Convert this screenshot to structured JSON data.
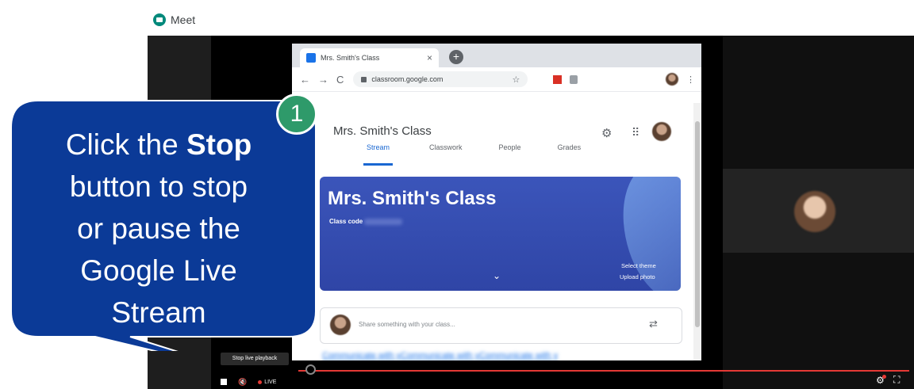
{
  "meet": {
    "title": "Meet"
  },
  "browser": {
    "tab_title": "Mrs. Smith's Class",
    "tab_close": "×",
    "new_tab": "+",
    "nav_back": "←",
    "nav_forward": "→",
    "reload": "C",
    "url": "classroom.google.com",
    "star": "☆",
    "menu": "⋮"
  },
  "classroom": {
    "class_title": "Mrs. Smith's Class",
    "tabs": [
      {
        "label": "Stream",
        "active": true
      },
      {
        "label": "Classwork",
        "active": false
      },
      {
        "label": "People",
        "active": false
      },
      {
        "label": "Grades",
        "active": false
      }
    ],
    "banner_title": "Mrs. Smith's Class",
    "class_code_label": "Class code",
    "select_theme": "Select theme",
    "upload_photo": "Upload photo",
    "share_placeholder": "Share something with your class...",
    "blurred_link": "Communicate with yCommunicate with yCommunicate with y"
  },
  "player": {
    "tooltip": "Stop live playback",
    "live_label": "LIVE",
    "progress_fraction": 1.0
  },
  "callout": {
    "step": "1",
    "line1_prefix": "Click the ",
    "line1_bold": "Stop",
    "line2": "button to stop",
    "line3": "or pause the",
    "line4": "Google Live",
    "line5": "Stream"
  },
  "colors": {
    "callout_fill": "#0b3a97",
    "step_badge": "#2e9a6a",
    "banner": "#3b55ba",
    "progress": "#e53935"
  },
  "icons": {
    "settings": "gear-icon",
    "apps": "apps-grid-icon",
    "repost": "repost-icon",
    "stop": "stop-icon",
    "volume": "volume-muted-icon",
    "fullscreen": "fullscreen-icon"
  }
}
